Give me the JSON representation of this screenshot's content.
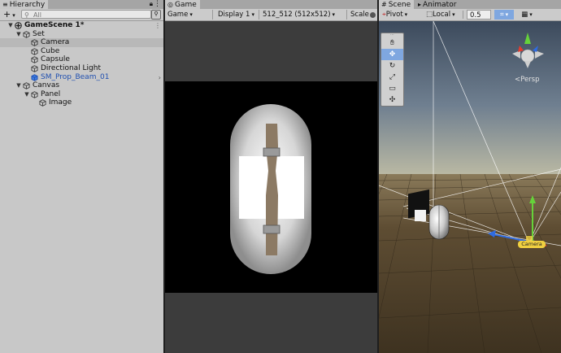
{
  "hierarchy": {
    "tab": "Hierarchy",
    "add_label": "+",
    "search_placeholder": "All",
    "rows": [
      {
        "label": "GameScene 1*",
        "depth": 0,
        "expanded": true,
        "kind": "scene",
        "bold": true
      },
      {
        "label": "Set",
        "depth": 1,
        "expanded": true,
        "kind": "object"
      },
      {
        "label": "Camera",
        "depth": 2,
        "kind": "object",
        "selected": true
      },
      {
        "label": "Cube",
        "depth": 2,
        "kind": "object"
      },
      {
        "label": "Capsule",
        "depth": 2,
        "kind": "object"
      },
      {
        "label": "Directional Light",
        "depth": 2,
        "kind": "object"
      },
      {
        "label": "SM_Prop_Beam_01",
        "depth": 2,
        "kind": "prefab",
        "has_child_arrow": true
      },
      {
        "label": "Canvas",
        "depth": 1,
        "expanded": true,
        "kind": "object"
      },
      {
        "label": "Panel",
        "depth": 2,
        "expanded": true,
        "kind": "object"
      },
      {
        "label": "Image",
        "depth": 3,
        "kind": "object"
      }
    ]
  },
  "game": {
    "tab": "Game",
    "display_mode": "Game",
    "display": "Display 1",
    "resolution": "512_512 (512x512)",
    "scale_label": "Scale"
  },
  "scene": {
    "tab": "Scene",
    "tab2": "Animator",
    "pivot": "Pivot",
    "space": "Local",
    "snap_value": "0.5",
    "persp_label": "<Persp",
    "camera_label": "Camera",
    "tools": [
      "hand-tool",
      "move-tool",
      "rotate-tool",
      "scale-tool",
      "rect-tool",
      "transform-tool"
    ]
  },
  "colors": {
    "panel_bg": "#c8c8c8",
    "selection": "#b8b8b8",
    "prefab_text": "#1f4fb0",
    "tool_active": "#7fa7e0",
    "sky_top": "#3c4a5c",
    "horizon": "#b9b8a3",
    "ground": "#5e4d33",
    "gizmo_y": "#66d23a",
    "gizmo_x": "#e63b2e",
    "gizmo_z": "#2f6be0"
  }
}
